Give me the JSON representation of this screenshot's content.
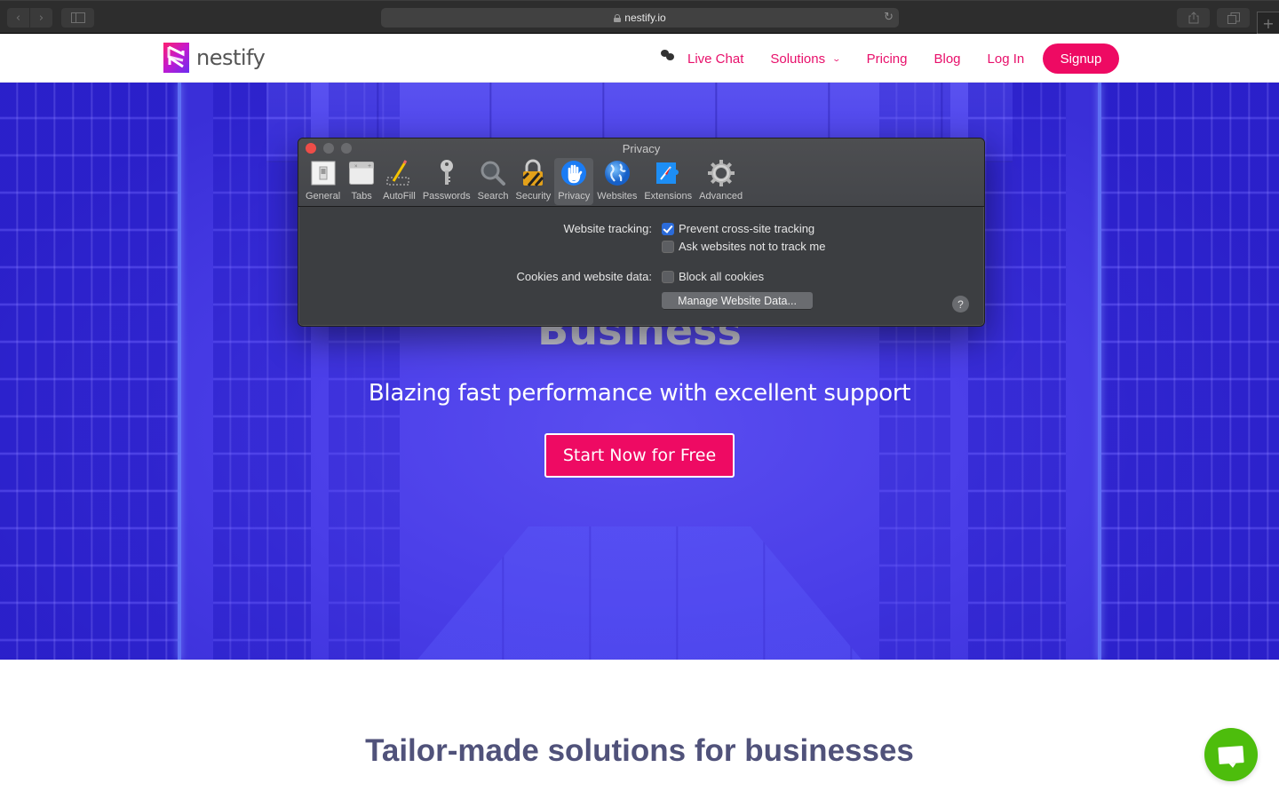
{
  "browser": {
    "url": "nestify.io",
    "buttons": {
      "back": "back",
      "forward": "forward",
      "sidebar": "sidebar",
      "share": "share",
      "tabs": "tabs",
      "new_tab": "+"
    }
  },
  "site": {
    "logo_text": "nestify",
    "nav": [
      {
        "label": "Live Chat",
        "icon": "chat-bubbles-icon"
      },
      {
        "label": "Solutions",
        "icon": "chevron-down-icon"
      },
      {
        "label": "Pricing"
      },
      {
        "label": "Blog"
      },
      {
        "label": "Log In"
      }
    ],
    "signup_label": "Signup",
    "brand_color": "#ee0a63",
    "hero": {
      "title": "Business",
      "subtitle": "Blazing fast performance with excellent support",
      "cta_label": "Start Now for Free"
    },
    "section_title": "Tailor-made solutions for businesses",
    "chat_widget_color": "#4dbd0c"
  },
  "prefs": {
    "title": "Privacy",
    "tabs": [
      {
        "label": "General",
        "icon": "general-switch-icon"
      },
      {
        "label": "Tabs",
        "icon": "tabs-icon"
      },
      {
        "label": "AutoFill",
        "icon": "autofill-pencil-icon"
      },
      {
        "label": "Passwords",
        "icon": "key-icon"
      },
      {
        "label": "Search",
        "icon": "magnifier-icon"
      },
      {
        "label": "Security",
        "icon": "padlock-icon"
      },
      {
        "label": "Privacy",
        "icon": "hand-icon",
        "active": true
      },
      {
        "label": "Websites",
        "icon": "globe-icon"
      },
      {
        "label": "Extensions",
        "icon": "compass-puzzle-icon"
      },
      {
        "label": "Advanced",
        "icon": "gear-icon"
      }
    ],
    "website_tracking_label": "Website tracking:",
    "prevent_tracking_label": "Prevent cross-site tracking",
    "prevent_tracking_checked": true,
    "ask_not_track_label": "Ask websites not to track me",
    "ask_not_track_checked": false,
    "cookies_label": "Cookies and website data:",
    "block_cookies_label": "Block all cookies",
    "block_cookies_checked": false,
    "manage_button_label": "Manage Website Data...",
    "help_label": "?"
  }
}
